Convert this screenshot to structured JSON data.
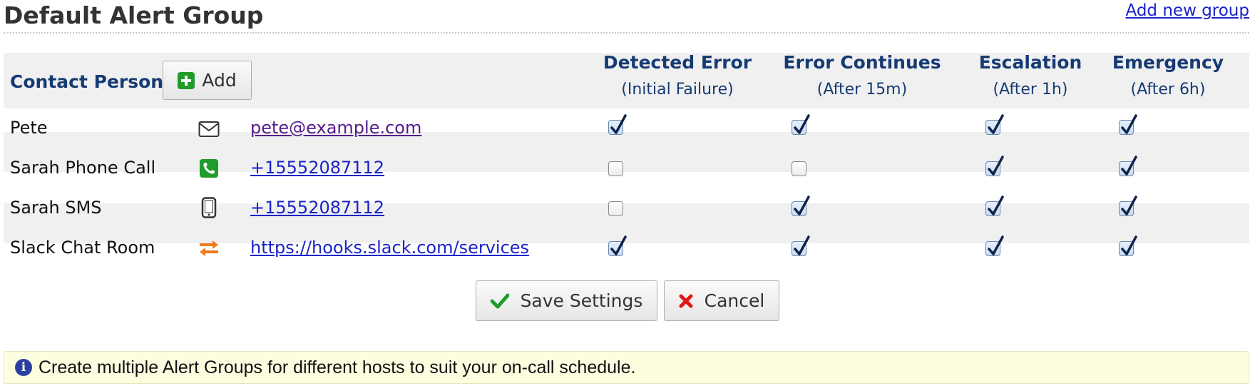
{
  "page": {
    "title": "Default Alert Group",
    "add_group_access_key": "A",
    "add_group_rest": "dd new group"
  },
  "table": {
    "contact_header": "Contact Person",
    "add_button": "Add",
    "columns": [
      {
        "title": "Detected Error",
        "subtitle": "(Initial Failure)"
      },
      {
        "title": "Error Continues",
        "subtitle": "(After 15m)"
      },
      {
        "title": "Escalation",
        "subtitle": "(After 1h)"
      },
      {
        "title": "Emergency",
        "subtitle": "(After 6h)"
      }
    ],
    "rows": [
      {
        "name": "Pete",
        "icon": "envelope-icon",
        "address": "pete@example.com",
        "checks": [
          true,
          true,
          true,
          true
        ]
      },
      {
        "name": "Sarah Phone Call",
        "icon": "phone-icon",
        "address": "+15552087112",
        "checks": [
          false,
          false,
          true,
          true
        ]
      },
      {
        "name": "Sarah SMS",
        "icon": "mobile-icon",
        "address": "+15552087112",
        "checks": [
          false,
          true,
          true,
          true
        ]
      },
      {
        "name": "Slack Chat Room",
        "icon": "webhook-arrows-icon",
        "address": "https://hooks.slack.com/services",
        "checks": [
          true,
          true,
          true,
          true
        ]
      }
    ]
  },
  "actions": {
    "save_label": "Save Settings",
    "cancel_label": "Cancel"
  },
  "info": {
    "text": "Create multiple Alert Groups for different hosts to suit your on-call schedule."
  },
  "colors": {
    "header_text": "#163b74",
    "link": "#1a22c8",
    "visited_link": "#551a8b",
    "add_icon": "#1f9c2a",
    "phone_icon": "#1f9c2a",
    "slack_icon": "#f07a1a",
    "cancel_icon": "#e01515",
    "save_icon": "#1f9c2a",
    "info_bg": "#fdfde0"
  }
}
